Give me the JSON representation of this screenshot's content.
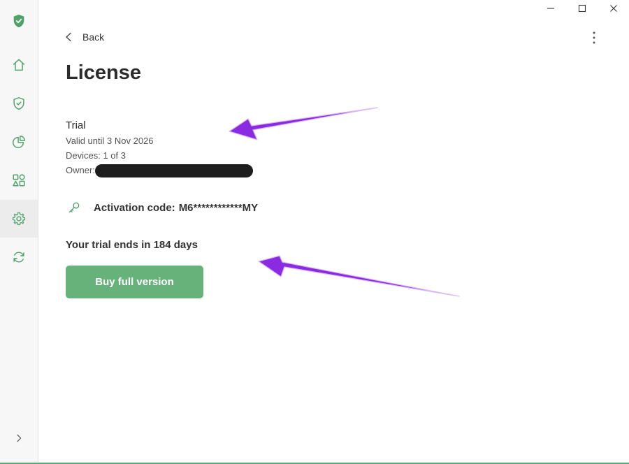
{
  "window": {
    "controls": [
      "minimize",
      "maximize",
      "close"
    ]
  },
  "sidebar": {
    "items": [
      {
        "id": "logo",
        "icon": "shield-check-filled-icon"
      },
      {
        "id": "home",
        "icon": "home-icon"
      },
      {
        "id": "protection",
        "icon": "shield-icon"
      },
      {
        "id": "statistics",
        "icon": "pie-chart-icon"
      },
      {
        "id": "apps",
        "icon": "apps-icon"
      },
      {
        "id": "settings",
        "icon": "gear-icon",
        "active": true
      },
      {
        "id": "updates",
        "icon": "sync-icon"
      }
    ],
    "expand_icon": "chevron-right-icon"
  },
  "header": {
    "back_label": "Back",
    "title": "License"
  },
  "license": {
    "plan": "Trial",
    "valid_until": "Valid until 3 Nov 2026",
    "devices": "Devices: 1 of 3",
    "owner_label": "Owner:",
    "activation_label": "Activation code:",
    "activation_code": "M6************MY",
    "trial_ends": "Your trial ends in 184 days",
    "buy_label": "Buy full version"
  },
  "colors": {
    "accent_green": "#67b27a",
    "icon_green": "#4fa36a",
    "annotation_purple": "#8a2be2"
  }
}
